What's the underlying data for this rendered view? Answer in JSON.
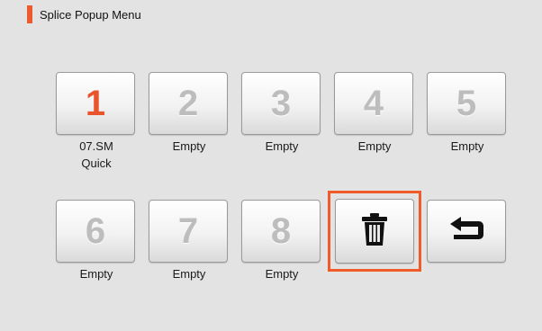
{
  "window": {
    "title": "Splice Popup Menu",
    "accent_color": "#ee5a30"
  },
  "slots": [
    {
      "number": "1",
      "label": "07.SM",
      "sublabel": "Quick",
      "active": true
    },
    {
      "number": "2",
      "label": "Empty",
      "sublabel": "",
      "active": false
    },
    {
      "number": "3",
      "label": "Empty",
      "sublabel": "",
      "active": false
    },
    {
      "number": "4",
      "label": "Empty",
      "sublabel": "",
      "active": false
    },
    {
      "number": "5",
      "label": "Empty",
      "sublabel": "",
      "active": false
    },
    {
      "number": "6",
      "label": "Empty",
      "sublabel": "",
      "active": false
    },
    {
      "number": "7",
      "label": "Empty",
      "sublabel": "",
      "active": false
    },
    {
      "number": "8",
      "label": "Empty",
      "sublabel": "",
      "active": false
    }
  ],
  "actions": {
    "delete_icon": "trash-icon",
    "back_icon": "return-arrow-icon",
    "highlight_color": "#ef5b2a"
  }
}
